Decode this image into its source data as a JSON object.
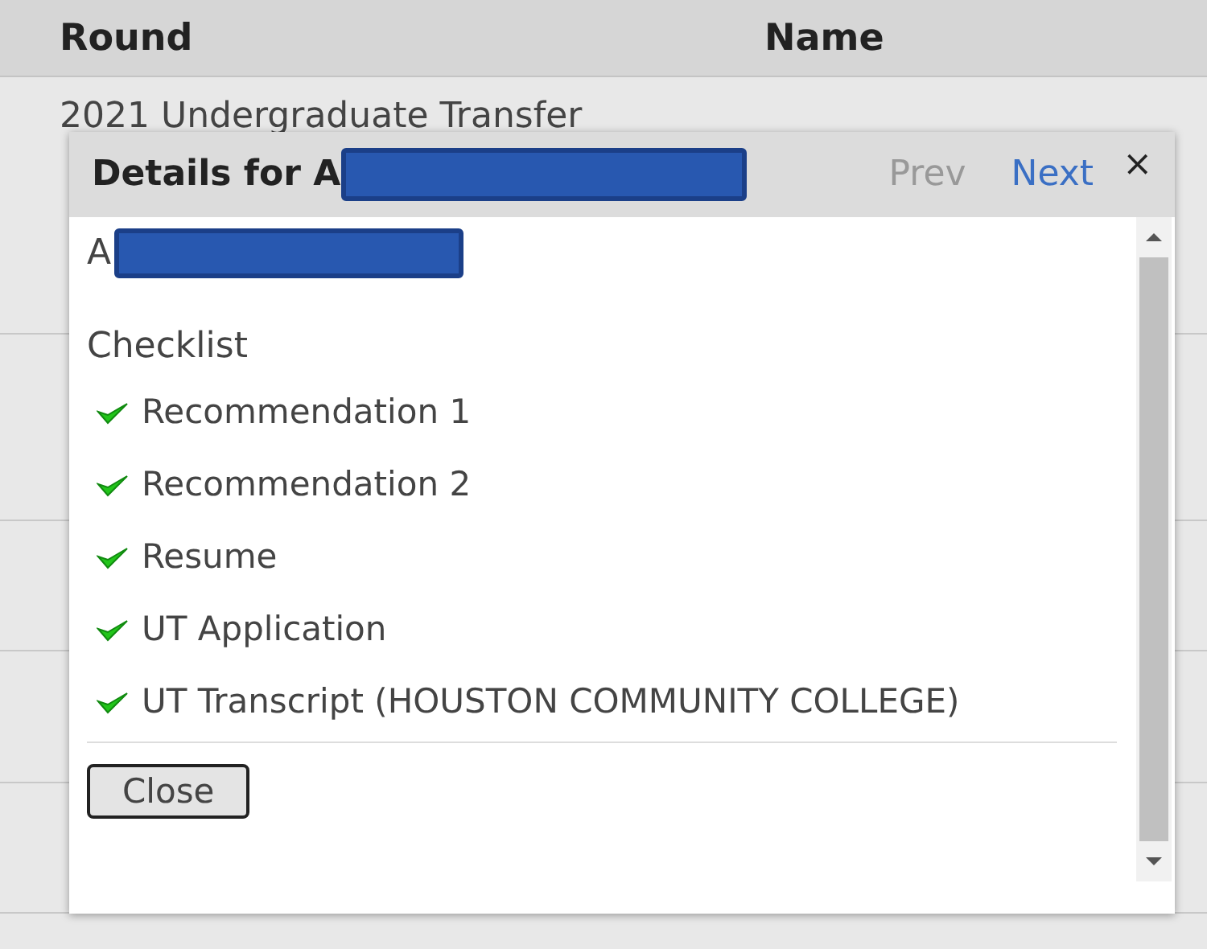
{
  "table": {
    "columns": [
      "Round",
      "Name"
    ],
    "rows": [
      {
        "round": "2021 Undergraduate Transfer"
      }
    ]
  },
  "dialog": {
    "title": "Details for A",
    "prev": "Prev",
    "next": "Next",
    "close_icon": "×",
    "applicant": "A",
    "checklist_heading": "Checklist",
    "checklist": [
      {
        "label": "Recommendation 1",
        "checked": true
      },
      {
        "label": "Recommendation 2",
        "checked": true
      },
      {
        "label": "Resume",
        "checked": true
      },
      {
        "label": "UT Application",
        "checked": true
      },
      {
        "label": "UT Transcript (HOUSTON COMMUNITY COLLEGE)",
        "checked": true
      }
    ],
    "close_button": "Close"
  }
}
